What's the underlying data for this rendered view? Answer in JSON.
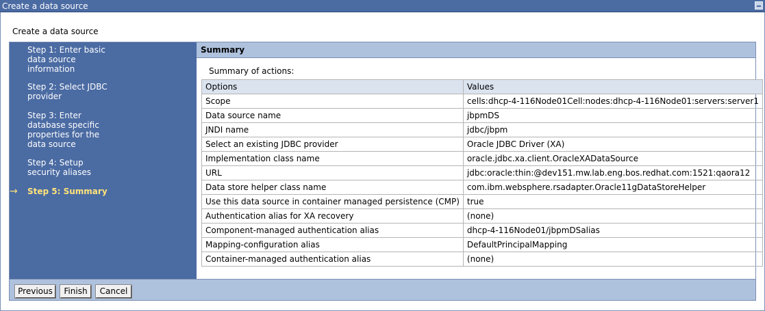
{
  "window": {
    "title": "Create a data source"
  },
  "page": {
    "heading": "Create a data source"
  },
  "steps": [
    {
      "label": "Step 1: Enter basic data source information",
      "current": false
    },
    {
      "label": "Step 2: Select JDBC provider",
      "current": false
    },
    {
      "label": "Step 3: Enter database specific properties for the data source",
      "current": false
    },
    {
      "label": "Step 4: Setup security aliases",
      "current": false
    },
    {
      "label": "Step 5: Summary",
      "current": true
    }
  ],
  "current_arrow": "→",
  "summary": {
    "title": "Summary",
    "label": "Summary of actions:",
    "columns": [
      "Options",
      "Values"
    ],
    "rows": [
      [
        "Scope",
        "cells:dhcp-4-116Node01Cell:nodes:dhcp-4-116Node01:servers:server1"
      ],
      [
        "Data source name",
        "jbpmDS"
      ],
      [
        "JNDI name",
        "jdbc/jbpm"
      ],
      [
        "Select an existing JDBC provider",
        "Oracle JDBC Driver (XA)"
      ],
      [
        "Implementation class name",
        "oracle.jdbc.xa.client.OracleXADataSource"
      ],
      [
        "URL",
        "jdbc:oracle:thin:@dev151.mw.lab.eng.bos.redhat.com:1521:qaora12"
      ],
      [
        "Data store helper class name",
        "com.ibm.websphere.rsadapter.Oracle11gDataStoreHelper"
      ],
      [
        "Use this data source in container managed persistence (CMP)",
        "true"
      ],
      [
        "Authentication alias for XA recovery",
        "(none)"
      ],
      [
        "Component-managed authentication alias",
        "dhcp-4-116Node01/jbpmDSalias"
      ],
      [
        "Mapping-configuration alias",
        "DefaultPrincipalMapping"
      ],
      [
        "Container-managed authentication alias",
        "(none)"
      ]
    ]
  },
  "buttons": {
    "previous": "Previous",
    "finish": "Finish",
    "cancel": "Cancel"
  },
  "colors": {
    "titlebar": "#4b6ba3",
    "nav": "#4b6ba3",
    "header": "#aec1dd",
    "current_step": "#ffe37a"
  }
}
